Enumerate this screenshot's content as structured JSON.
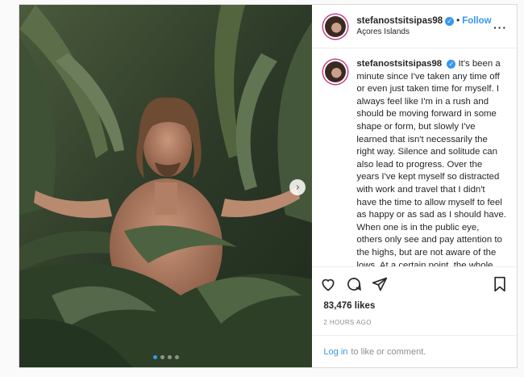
{
  "post": {
    "username": "stefanostsitsipas98",
    "separator": "•",
    "follow_label": "Follow",
    "location": "Açores Islands",
    "caption": "It's been a minute since I've taken any time off or even just taken time for myself. I always feel like I'm in a rush and should be moving forward in some shape or form, but slowly I've learned that isn't necessarily the right way. Silence and solitude can also lead to progress. Over the years I've kept myself so distracted with work and travel that I didn't have the time to allow myself to feel as happy or as sad as I should have. When one is in the public eye, others only see and pay attention to the highs, but are not aware of the lows. At a certain point, the whole thing caught up to me and it's been an eye opening experience to say the least. Put emphasis on your well-being, love as hard as you can,",
    "likes": "83,476 likes",
    "timestamp": "2 HOURS AGO",
    "login_link": "Log in",
    "login_text": "to like or comment.",
    "carousel": {
      "current": 1,
      "total": 4
    }
  },
  "icons": {
    "verified": "verified-badge-icon",
    "more": "more-options-icon",
    "like": "heart-icon",
    "comment": "comment-icon",
    "share": "share-icon",
    "save": "bookmark-icon",
    "next": "chevron-right-icon"
  },
  "colors": {
    "accent": "#3897f0",
    "muted": "#8e8e8e",
    "text": "#262626",
    "border": "#dbdbdb"
  }
}
